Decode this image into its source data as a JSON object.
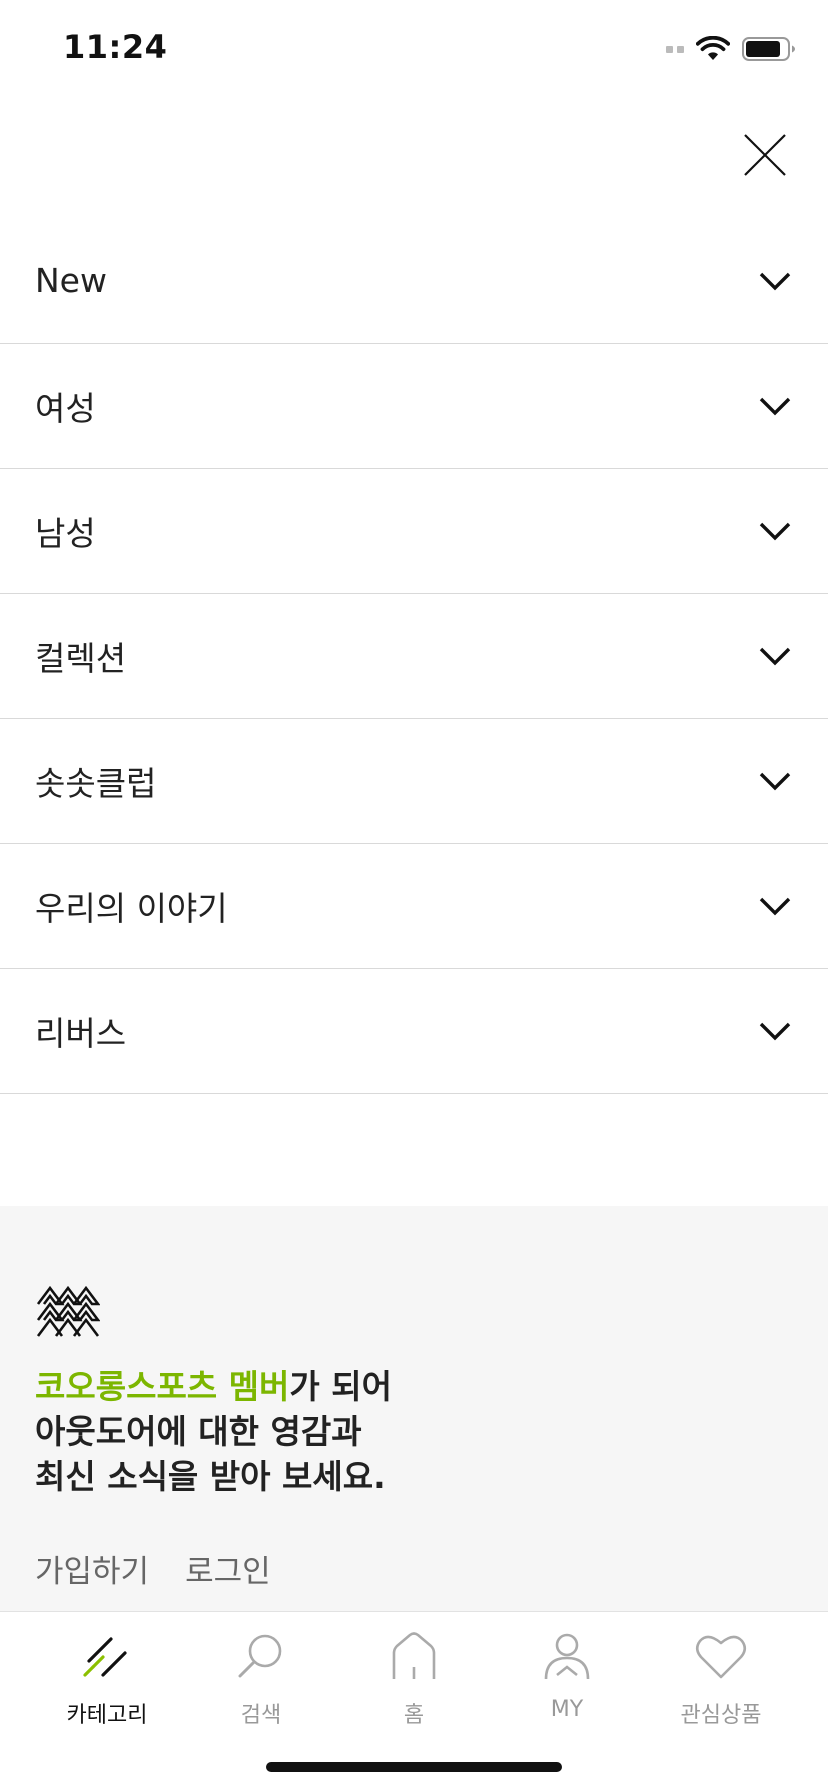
{
  "status_bar": {
    "time": "11:24",
    "icons": [
      "signal-icon",
      "wifi-icon",
      "battery-icon"
    ]
  },
  "header": {
    "close_icon": "close-icon"
  },
  "menu": {
    "items": [
      {
        "label": "New"
      },
      {
        "label": "여성"
      },
      {
        "label": "남성"
      },
      {
        "label": "컬렉션"
      },
      {
        "label": "솟솟클럽"
      },
      {
        "label": "우리의 이야기"
      },
      {
        "label": "리버스"
      }
    ]
  },
  "promo": {
    "logo_icon": "kolon-sport-logo-icon",
    "accent_text": "코오롱스포츠 멤버",
    "line1_rest": "가 되어",
    "line2": "아웃도어에 대한 영감과",
    "line3": "최신 소식을 받아 보세요.",
    "signup_label": "가입하기",
    "login_label": "로그인",
    "accent_color": "#7cb600"
  },
  "tabbar": {
    "tabs": [
      {
        "label": "카테고리",
        "icon": "category-icon",
        "active": true
      },
      {
        "label": "검색",
        "icon": "search-icon",
        "active": false
      },
      {
        "label": "홈",
        "icon": "home-icon",
        "active": false
      },
      {
        "label": "MY",
        "icon": "user-icon",
        "active": false
      },
      {
        "label": "관심상품",
        "icon": "heart-icon",
        "active": false
      }
    ]
  }
}
